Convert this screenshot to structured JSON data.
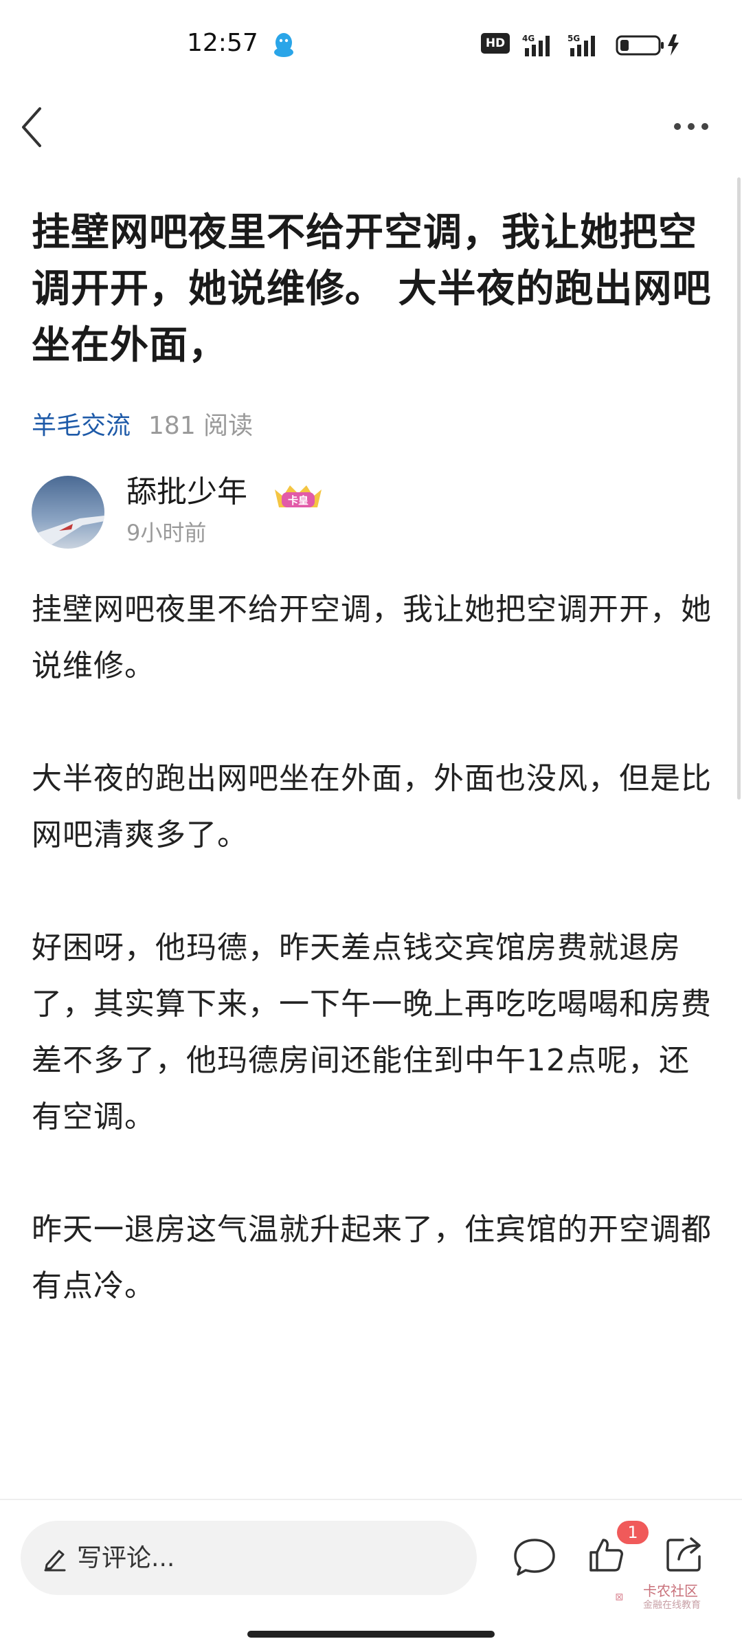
{
  "status_bar": {
    "time": "12:57",
    "hd_label": "HD",
    "network_1": "4G",
    "network_2": "5G",
    "icons": [
      "qq-icon",
      "hd-icon",
      "signal-4g-icon",
      "signal-5g-icon",
      "battery-icon",
      "charging-icon"
    ]
  },
  "nav": {
    "icons": [
      "back-icon",
      "more-icon"
    ]
  },
  "post": {
    "title": "挂壁网吧夜里不给开空调，我让她把空调开开，她说维修。 大半夜的跑出网吧坐在外面，",
    "category": "羊毛交流",
    "read_count": "181 阅读",
    "author": {
      "name": "舔批少年",
      "badge": "卡皇",
      "time": "9小时前"
    },
    "paragraphs": [
      "挂壁网吧夜里不给开空调，我让她把空调开开，她说维修。",
      "大半夜的跑出网吧坐在外面，外面也没风，但是比网吧清爽多了。",
      "好困呀，他玛德，昨天差点钱交宾馆房费就退房了，其实算下来，一下午一晚上再吃吃喝喝和房费差不多了，他玛德房间还能住到中午12点呢，还有空调。",
      "昨天一退房这气温就升起来了，住宾馆的开空调都有点冷。"
    ]
  },
  "bottom_bar": {
    "comment_placeholder": "写评论...",
    "like_count": "1",
    "watermark_title": "卡农社区",
    "watermark_subtitle": "金融在线教育",
    "icons": [
      "pencil-icon",
      "chat-icon",
      "like-icon",
      "share-icon"
    ]
  },
  "colors": {
    "category": "#1e5aa8",
    "muted": "#9a9a9a",
    "badge_red": "#f05a5a"
  }
}
